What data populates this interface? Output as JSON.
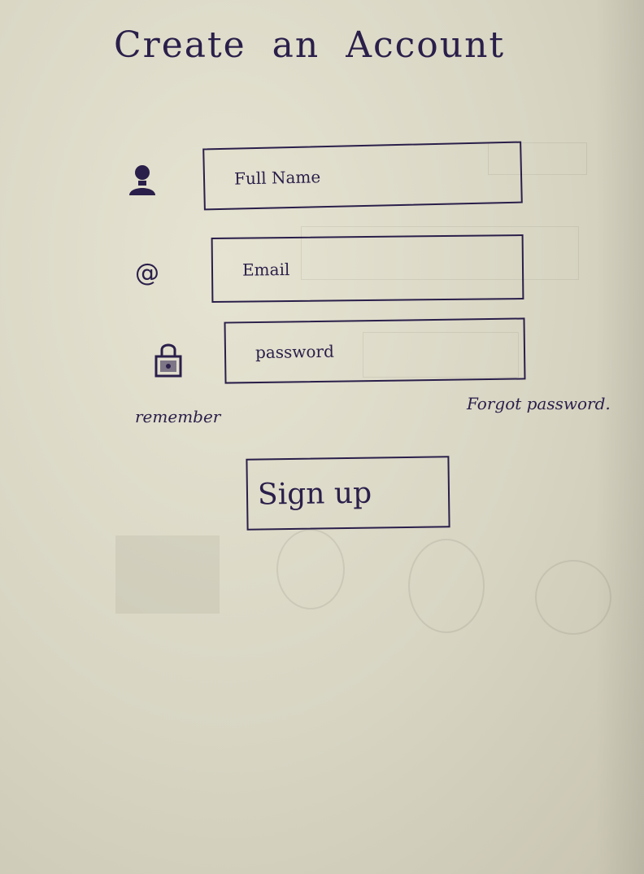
{
  "title": "Create  an  Account",
  "fields": {
    "full_name": {
      "placeholder": "Full Name",
      "icon": "user-icon"
    },
    "email": {
      "placeholder": "Email",
      "icon": "at-sign-icon",
      "icon_glyph": "@"
    },
    "password": {
      "placeholder": "password",
      "icon": "lock-icon"
    }
  },
  "links": {
    "remember": "remember",
    "forgot_password": "Forgot password."
  },
  "buttons": {
    "signup": "Sign up"
  },
  "colors": {
    "ink": "#2a1f4a",
    "paper": "#e6e3d2"
  }
}
